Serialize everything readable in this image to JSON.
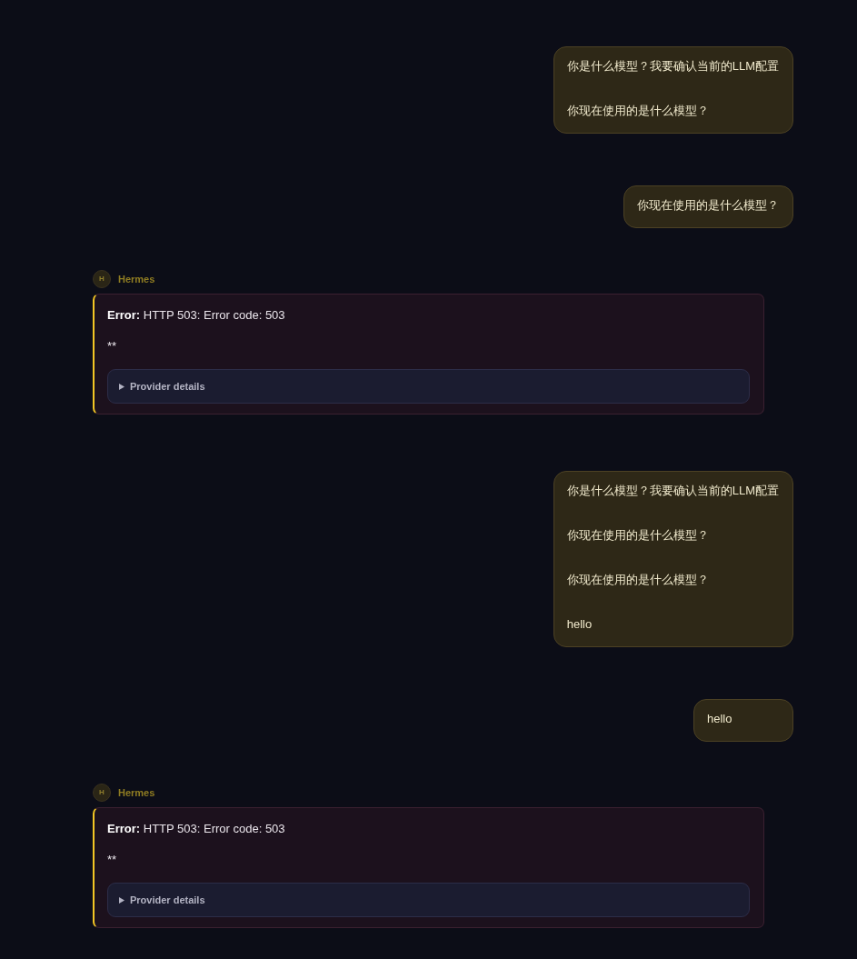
{
  "messages": [
    {
      "kind": "user",
      "paragraphs": [
        "你是什么模型？我要确认当前的LLM配置",
        "你现在使用的是什么模型？"
      ]
    },
    {
      "kind": "user",
      "paragraphs": [
        "你现在使用的是什么模型？"
      ]
    },
    {
      "kind": "assistant",
      "sender": "Hermes",
      "avatar": "H",
      "error": "**Error:** HTTP 503: Error code: 503",
      "body": "**",
      "details": {
        "label": "Provider details",
        "expanded": false
      }
    },
    {
      "kind": "user",
      "paragraphs": [
        "你是什么模型？我要确认当前的LLM配置",
        "你现在使用的是什么模型？",
        "你现在使用的是什么模型？",
        "hello"
      ]
    },
    {
      "kind": "user",
      "paragraphs": [
        "hello"
      ]
    },
    {
      "kind": "assistant",
      "sender": "Hermes",
      "avatar": "H",
      "error": "**Error:** HTTP 503: Error code: 503",
      "body": "**",
      "details": {
        "label": "Provider details",
        "expanded": false
      }
    }
  ]
}
